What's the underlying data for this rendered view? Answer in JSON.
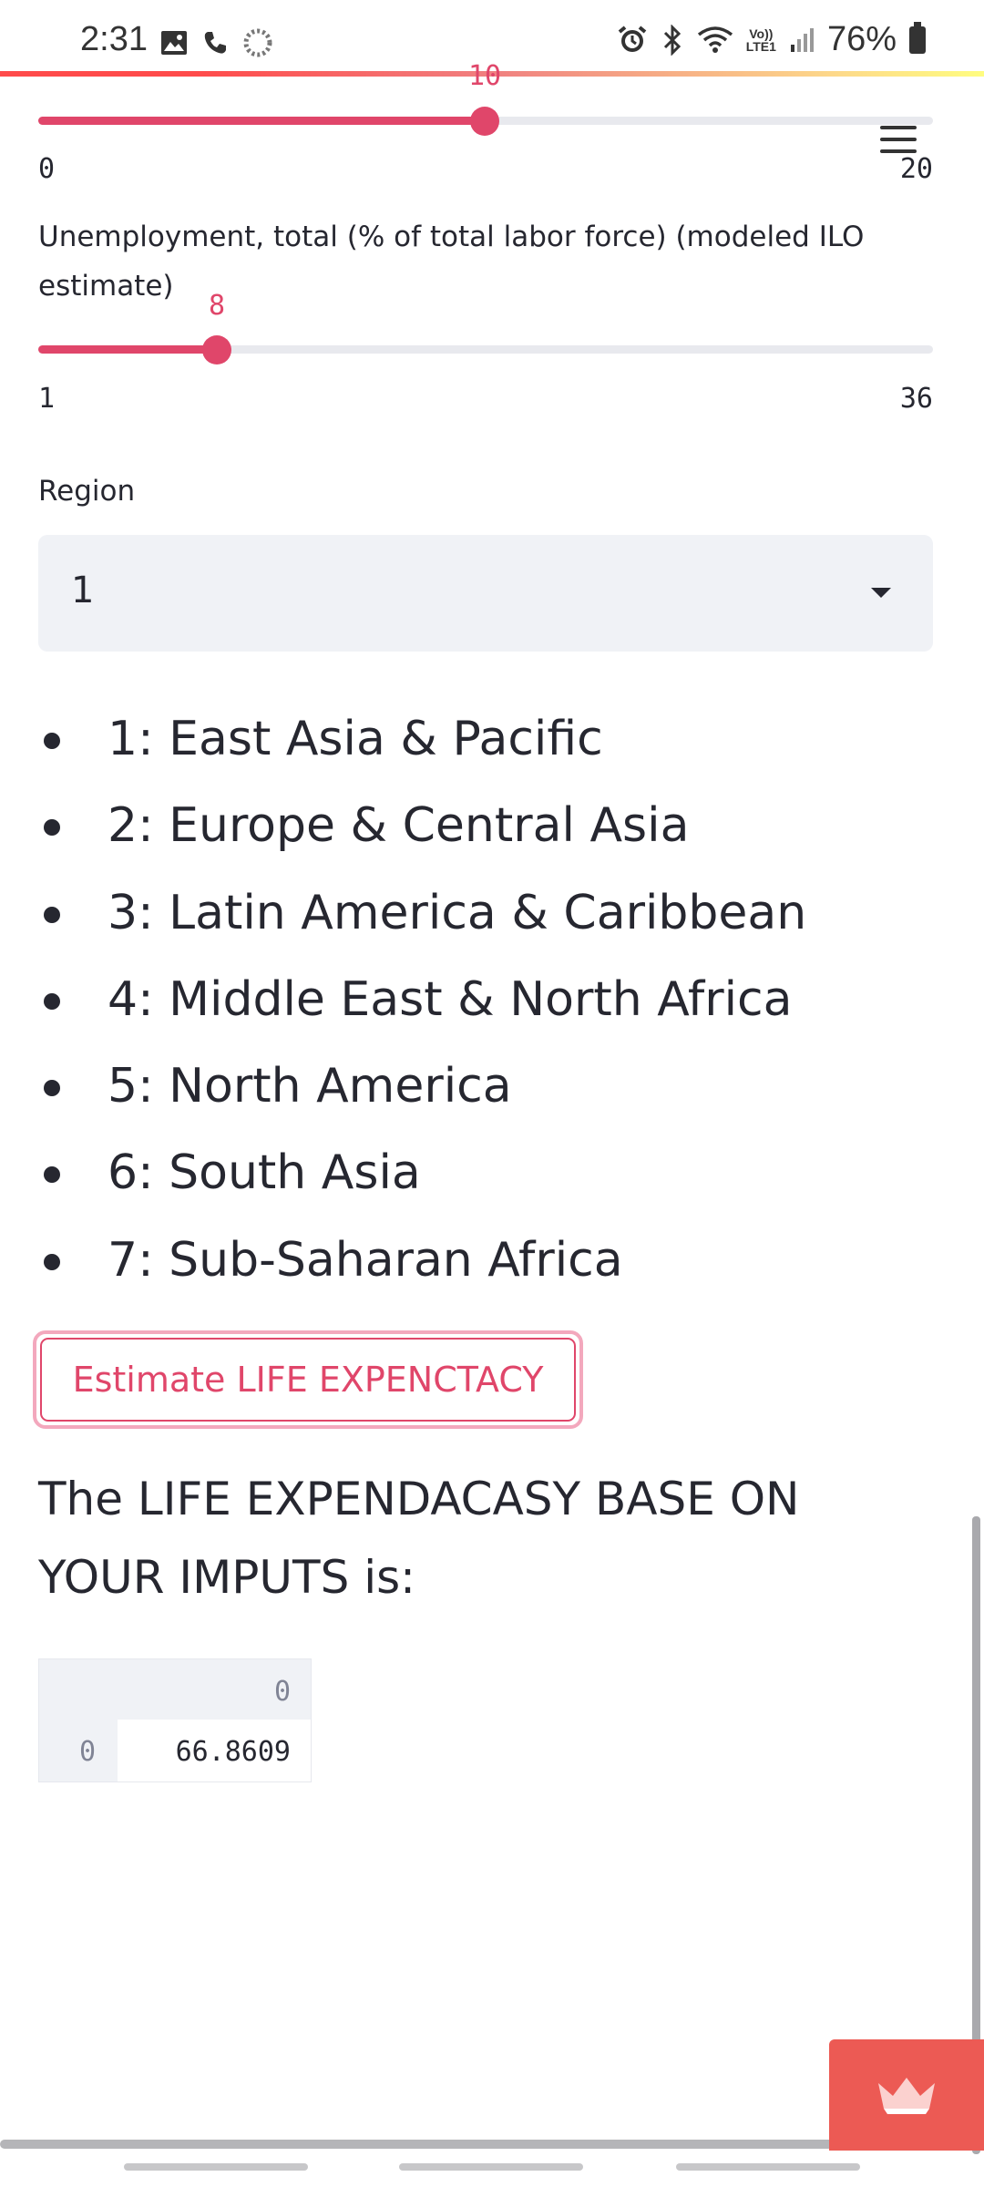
{
  "status_bar": {
    "time": "2:31",
    "battery": "76%",
    "network": "LTE1",
    "volte": "Vo))",
    "icons_left": [
      "image-icon",
      "phone-icon",
      "loading-icon"
    ],
    "icons_right": [
      "alarm-icon",
      "bluetooth-icon",
      "wifi-icon",
      "signal-icon",
      "battery-icon"
    ]
  },
  "colors": {
    "accent": "#e0466a",
    "text": "#262730",
    "select_bg": "#f0f2f6",
    "badge": "#ec5a54"
  },
  "slider_top": {
    "value": "10",
    "min": "0",
    "max": "20"
  },
  "slider_unemployment": {
    "label": "Unemployment, total (% of total labor force) (modeled ILO estimate)",
    "value": "8",
    "min": "1",
    "max": "36"
  },
  "region": {
    "label": "Region",
    "selected": "1"
  },
  "regions": [
    "1: East Asia & Pacific",
    "2: Europe & Central Asia",
    "3: Latin America & Caribbean",
    "4: Middle East & North Africa",
    "5: North America",
    "6: South Asia",
    "7: Sub-Saharan Africa"
  ],
  "button": {
    "label": "Estimate LIFE EXPENCTACY"
  },
  "result": {
    "text": "The LIFE EXPENDACASY BASE ON YOUR IMPUTS is:",
    "table": {
      "column_header": "0",
      "row_index": "0",
      "value": "66.8609"
    }
  }
}
